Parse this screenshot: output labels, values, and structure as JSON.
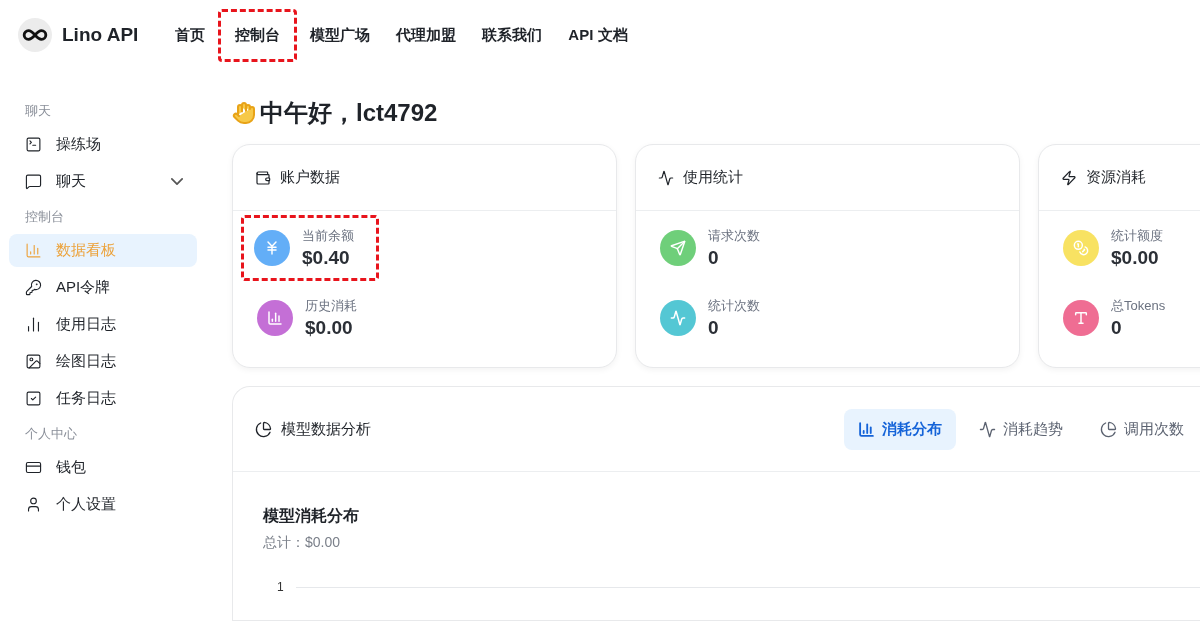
{
  "header": {
    "brand": "Lino API",
    "nav": [
      {
        "label": "首页",
        "annotated": false
      },
      {
        "label": "控制台",
        "annotated": true
      },
      {
        "label": "模型广场",
        "annotated": false
      },
      {
        "label": "代理加盟",
        "annotated": false
      },
      {
        "label": "联系我们",
        "annotated": false
      },
      {
        "label": "API 文档",
        "annotated": false
      }
    ]
  },
  "sidebar": {
    "sections": [
      {
        "title": "聊天",
        "items": [
          {
            "label": "操练场",
            "kind": "link",
            "selected": false
          },
          {
            "label": "聊天",
            "kind": "group",
            "selected": false
          }
        ]
      },
      {
        "title": "控制台",
        "items": [
          {
            "label": "数据看板",
            "kind": "link",
            "selected": true
          },
          {
            "label": "API令牌",
            "kind": "link",
            "selected": false
          },
          {
            "label": "使用日志",
            "kind": "link",
            "selected": false
          },
          {
            "label": "绘图日志",
            "kind": "link",
            "selected": false
          },
          {
            "label": "任务日志",
            "kind": "link",
            "selected": false
          }
        ]
      },
      {
        "title": "个人中心",
        "items": [
          {
            "label": "钱包",
            "kind": "link",
            "selected": false
          },
          {
            "label": "个人设置",
            "kind": "link",
            "selected": false
          }
        ]
      }
    ]
  },
  "greeting": "中午好，lct4792",
  "cards": [
    {
      "title": "账户数据",
      "stats": [
        {
          "label": "当前余额",
          "value": "$0.40",
          "color": "#63aef7",
          "annotated": true
        },
        {
          "label": "历史消耗",
          "value": "$0.00",
          "color": "#c46fd6",
          "annotated": false
        }
      ]
    },
    {
      "title": "使用统计",
      "stats": [
        {
          "label": "请求次数",
          "value": "0",
          "color": "#6fcf7a",
          "annotated": false
        },
        {
          "label": "统计次数",
          "value": "0",
          "color": "#54c7d4",
          "annotated": false
        }
      ]
    },
    {
      "title": "资源消耗",
      "stats": [
        {
          "label": "统计额度",
          "value": "$0.00",
          "color": "#f8e262",
          "annotated": false
        },
        {
          "label": "总Tokens",
          "value": "0",
          "color": "#ef6d93",
          "annotated": false
        }
      ]
    }
  ],
  "analysis": {
    "title": "模型数据分析",
    "tabs": [
      {
        "label": "消耗分布",
        "selected": true
      },
      {
        "label": "消耗趋势",
        "selected": false
      },
      {
        "label": "调用次数",
        "selected": false
      }
    ],
    "chart_title": "模型消耗分布",
    "total": "总计：$0.00",
    "y_tick": "1"
  }
}
